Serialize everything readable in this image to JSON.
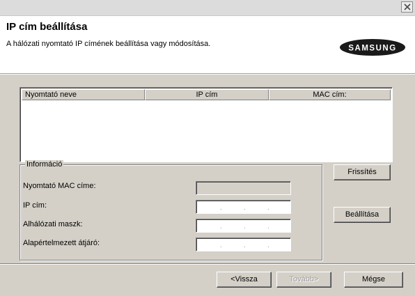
{
  "window": {
    "close_icon": "close-icon"
  },
  "header": {
    "title": "IP cím beállítása",
    "subtitle": "A hálózati nyomtató IP címének beállítása vagy módosítása.",
    "logo": "SAMSUNG"
  },
  "printer_list": {
    "columns": [
      "Nyomtató neve",
      "IP cím",
      "MAC cím:"
    ],
    "rows": []
  },
  "info": {
    "legend": "Információ",
    "mac_label": "Nyomtató MAC címe:",
    "mac_value": "",
    "ip_label": "IP cím:",
    "subnet_label": "Alhálózati maszk:",
    "gateway_label": "Alapértelmezett átjáró:",
    "ip_separator": "."
  },
  "buttons": {
    "refresh": "Frissítés",
    "configure": "Beállítása",
    "back": "<Vissza",
    "next": "Tovább>",
    "cancel": "Mégse"
  }
}
